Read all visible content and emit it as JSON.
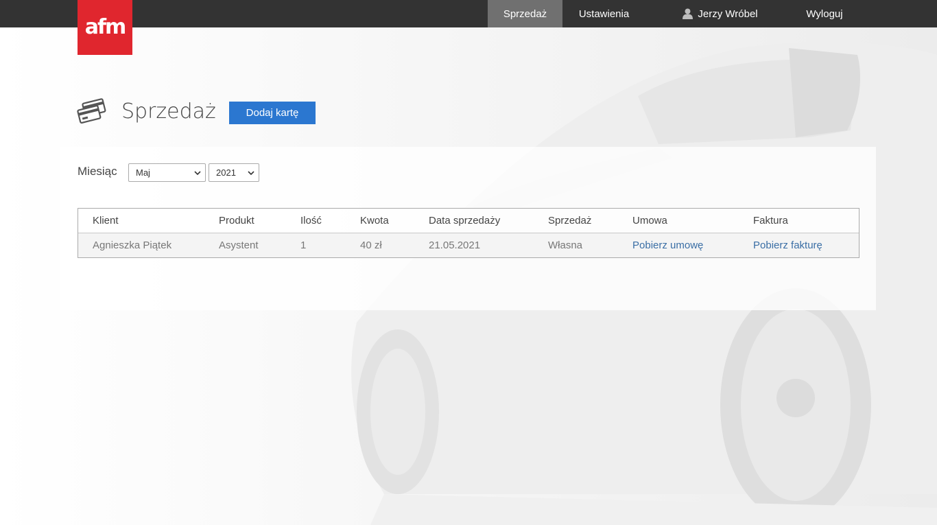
{
  "brand": {
    "logo_text": "afm",
    "color": "#e0262e"
  },
  "nav": {
    "sales": "Sprzedaż",
    "settings": "Ustawienia",
    "user": "Jerzy Wróbel",
    "logout": "Wyloguj"
  },
  "page": {
    "title": "Sprzedaż",
    "add_button": "Dodaj kartę"
  },
  "filter": {
    "label": "Miesiąc",
    "month": "Maj",
    "year": "2021"
  },
  "table": {
    "headers": [
      "Klient",
      "Produkt",
      "Ilość",
      "Kwota",
      "Data sprzedaży",
      "Sprzedaż",
      "Umowa",
      "Faktura"
    ],
    "rows": [
      [
        "Agnieszka Piątek",
        "Asystent",
        "1",
        "40 zł",
        "21.05.2021",
        "Własna",
        "Pobierz umowę",
        "Pobierz fakturę"
      ]
    ]
  },
  "colors": {
    "accent": "#2b77d0",
    "topbar": "#333333",
    "link": "#3a6ea5"
  }
}
